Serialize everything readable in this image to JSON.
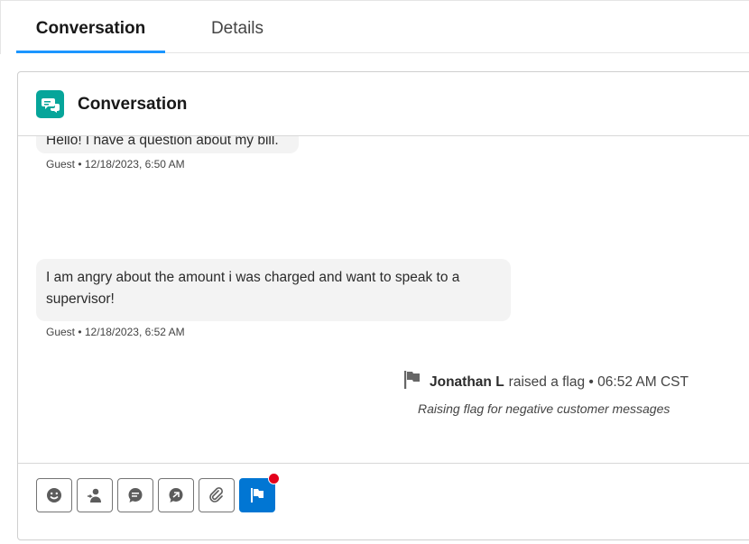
{
  "tabs": [
    {
      "label": "Conversation",
      "active": true
    },
    {
      "label": "Details",
      "active": false
    }
  ],
  "card": {
    "title": "Conversation",
    "icon": "chat-icon",
    "accent": "#06a59a"
  },
  "messages": [
    {
      "text": "Hello! I have a question about my bill.",
      "meta": "Guest • 12/18/2023, 6:50 AM"
    },
    {
      "text": "I am angry about the amount i was charged and want to speak to a supervisor!",
      "meta": "Guest • 12/18/2023, 6:52 AM"
    }
  ],
  "flag_event": {
    "icon": "flag-icon",
    "user": "Jonathan L",
    "action": "raised a flag • 06:52 AM CST",
    "note": "Raising flag for negative customer messages"
  },
  "toolbar": {
    "buttons": [
      {
        "icon": "emoji-icon"
      },
      {
        "icon": "transfer-user-icon"
      },
      {
        "icon": "quick-text-icon"
      },
      {
        "icon": "end-chat-icon"
      },
      {
        "icon": "attachment-icon"
      },
      {
        "icon": "flag-icon",
        "active": true,
        "notification": true
      }
    ],
    "active_color": "#0176d3",
    "notification_color": "#e3001b"
  }
}
